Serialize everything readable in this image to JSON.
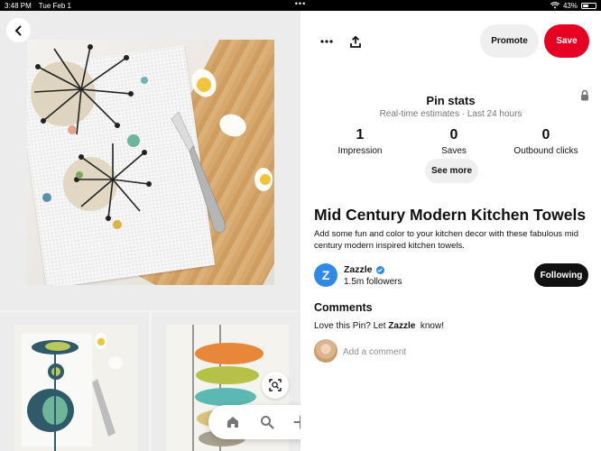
{
  "status_bar": {
    "time": "3:48 PM",
    "date": "Tue Feb 1",
    "dots": "•••",
    "battery": "43%"
  },
  "colors": {
    "save": "#e60023",
    "accent_blue": "#2f8ae6",
    "following_bg": "#111111"
  },
  "toolbar": {
    "more_icon": "more-horizontal-icon",
    "share_icon": "share-upload-icon",
    "promote_label": "Promote",
    "save_label": "Save"
  },
  "pin_stats": {
    "title": "Pin stats",
    "subtitle": "Real-time estimates · Last 24 hours",
    "stats": [
      {
        "value": "1",
        "label": "Impression"
      },
      {
        "value": "0",
        "label": "Saves"
      },
      {
        "value": "0",
        "label": "Outbound clicks"
      }
    ],
    "see_more_label": "See more"
  },
  "pin": {
    "title": "Mid Century Modern Kitchen Towels",
    "description": "Add some fun and color to your kitchen decor with these fabulous mid century modern inspired kitchen towels."
  },
  "creator": {
    "logo_letter": "Z",
    "name": "Zazzle",
    "followers": "1.5m followers",
    "following_label": "Following"
  },
  "comments": {
    "heading": "Comments",
    "prompt_before": "Love this Pin? Let ",
    "prompt_name": "Zazzle",
    "prompt_after": "  know!",
    "input_placeholder": "Add a comment"
  },
  "bottom_nav": [
    "home-icon",
    "search-icon",
    "plus-icon",
    "chat-icon",
    "profile-avatar"
  ]
}
